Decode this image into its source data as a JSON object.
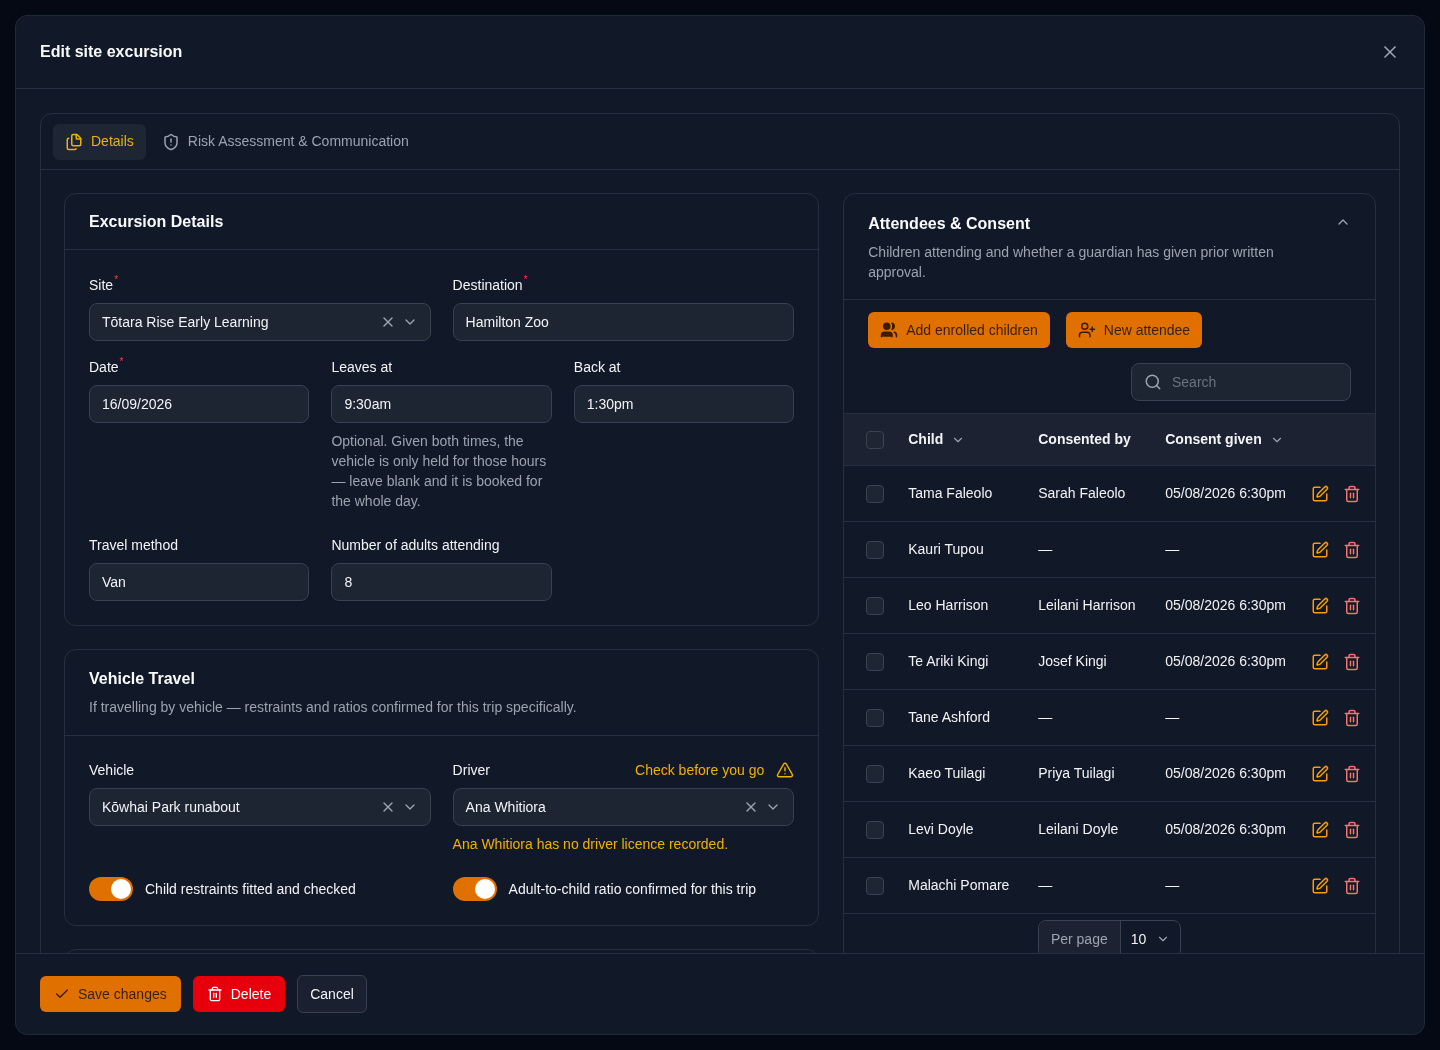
{
  "dialog": {
    "title": "Edit site excursion"
  },
  "tabs": [
    {
      "label": "Details",
      "selected": true,
      "kind": "files"
    },
    {
      "label": "Risk Assessment & Communication",
      "selected": false,
      "kind": "shield"
    }
  ],
  "excursion_details": {
    "title": "Excursion Details",
    "site": {
      "label": "Site",
      "required_marker": "*",
      "value": "Tōtara Rise Early Learning"
    },
    "destination": {
      "label": "Destination",
      "required_marker": "*",
      "value": "Hamilton Zoo"
    },
    "date": {
      "label": "Date",
      "required_marker": "*",
      "value": "16/09/2026"
    },
    "leaves_at": {
      "label": "Leaves at",
      "value": "9:30am",
      "help": "Optional. Given both times, the vehicle is only held for those hours — leave blank and it is booked for the whole day."
    },
    "back_at": {
      "label": "Back at",
      "value": "1:30pm"
    },
    "travel_method": {
      "label": "Travel method",
      "value": "Van"
    },
    "adults": {
      "label": "Number of adults attending",
      "value": "8"
    }
  },
  "vehicle_travel": {
    "title": "Vehicle Travel",
    "subtitle": "If travelling by vehicle — restraints and ratios confirmed for this trip specifically.",
    "vehicle": {
      "label": "Vehicle",
      "value": "Kōwhai Park runabout"
    },
    "driver": {
      "label": "Driver",
      "value": "Ana Whitiora",
      "warning_link": "Check before you go",
      "warning": "Ana Whitiora has no driver licence recorded."
    },
    "toggles": [
      {
        "label": "Child restraints fitted and checked",
        "on": true
      },
      {
        "label": "Adult-to-child ratio confirmed for this trip",
        "on": true
      }
    ]
  },
  "attendees": {
    "title": "Attendees & Consent",
    "subtitle": "Children attending and whether a guardian has given prior written approval.",
    "expanded": true,
    "buttons": [
      {
        "label": "Add enrolled children",
        "kind": "users"
      },
      {
        "label": "New attendee",
        "kind": "user-plus"
      }
    ],
    "search": {
      "placeholder": "Search"
    },
    "table": {
      "all_checked": false,
      "columns": [
        {
          "label": "Child",
          "sortable": true
        },
        {
          "label": "Consented by",
          "sortable": false
        },
        {
          "label": "Consent given",
          "sortable": true
        }
      ],
      "rows": [
        {
          "child": "Tama Faleolo",
          "consented_by": "Sarah Faleolo",
          "consent_given": "05/08/2026 6:30pm",
          "checked": false
        },
        {
          "child": "Kauri Tupou",
          "consented_by": "—",
          "consent_given": "—",
          "checked": false
        },
        {
          "child": "Leo Harrison",
          "consented_by": "Leilani Harrison",
          "consent_given": "05/08/2026 6:30pm",
          "checked": false
        },
        {
          "child": "Te Ariki Kingi",
          "consented_by": "Josef Kingi",
          "consent_given": "05/08/2026 6:30pm",
          "checked": false
        },
        {
          "child": "Tane Ashford",
          "consented_by": "—",
          "consent_given": "—",
          "checked": false
        },
        {
          "child": "Kaeo Tuilagi",
          "consented_by": "Priya Tuilagi",
          "consent_given": "05/08/2026 6:30pm",
          "checked": false
        },
        {
          "child": "Levi Doyle",
          "consented_by": "Leilani Doyle",
          "consent_given": "05/08/2026 6:30pm",
          "checked": false
        },
        {
          "child": "Malachi Pomare",
          "consented_by": "—",
          "consent_given": "—",
          "checked": false
        }
      ]
    },
    "pagination": {
      "label": "Per page",
      "value": "10"
    }
  },
  "footer_buttons": [
    {
      "label": "Save changes",
      "kind": "save"
    },
    {
      "label": "Delete",
      "kind": "delete"
    },
    {
      "label": "Cancel",
      "kind": "cancel"
    }
  ]
}
